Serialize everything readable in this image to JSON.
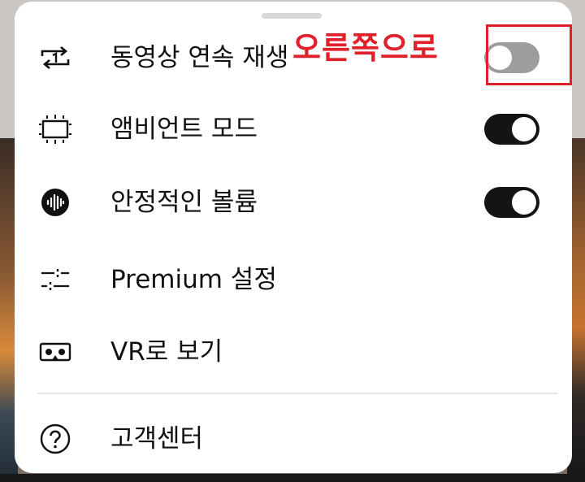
{
  "menu": {
    "items": [
      {
        "label": "동영상 연속 재생",
        "icon": "repeat-one-icon",
        "toggle": "off"
      },
      {
        "label": "앰비언트 모드",
        "icon": "ambient-mode-icon",
        "toggle": "on"
      },
      {
        "label": "안정적인 볼륨",
        "icon": "stable-volume-icon",
        "toggle": "on"
      },
      {
        "label": "Premium 설정",
        "icon": "sliders-icon"
      },
      {
        "label": "VR로 보기",
        "icon": "vr-headset-icon"
      },
      {
        "label": "고객센터",
        "icon": "help-circle-icon"
      }
    ]
  },
  "annotation": {
    "text": "오른쪽으로",
    "color": "#e0202a"
  },
  "colors": {
    "toggle_on": "#141414",
    "toggle_off": "#9d9d9d",
    "annotation": "#e0202a"
  }
}
